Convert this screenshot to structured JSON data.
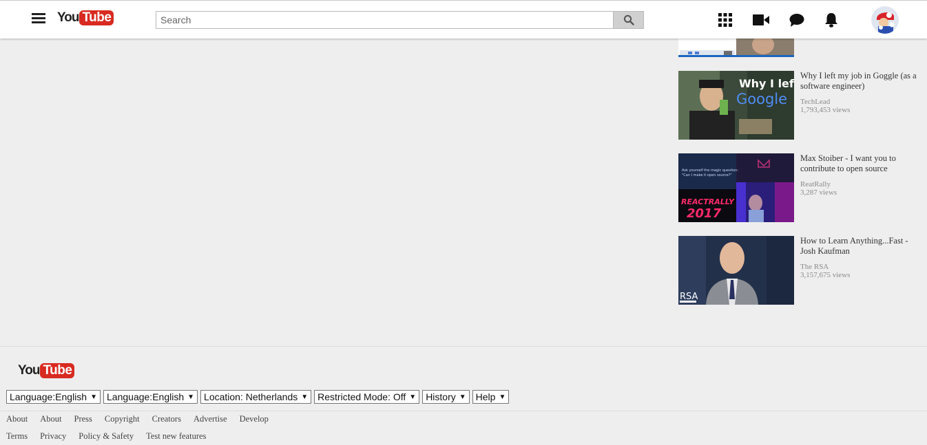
{
  "header": {
    "logo_you": "You",
    "logo_tube": "Tube",
    "search_placeholder": "Search"
  },
  "related": [
    {
      "title": "Why I left my job in Goggle (as a software engineer)",
      "channel": "TechLead",
      "views": "1,793,453 views",
      "thumb_text_1": "Why I left",
      "thumb_text_2": "Google"
    },
    {
      "title": "Max Stoiber - I want you to contribute to open source",
      "channel": "ReatRally",
      "views": "3,287 views",
      "thumb_text_1": "REACTRALLY",
      "thumb_text_2": "2017",
      "thumb_text_3": "Ask yourself the magic question:",
      "thumb_text_4": "\"Can I make it open source?\""
    },
    {
      "title": "How to Learn Anything...Fast - Josh Kaufman",
      "channel": "The RSA",
      "views": "3,157,675 views",
      "thumb_text_1": "RSA"
    }
  ],
  "footer": {
    "logo_you": "You",
    "logo_tube": "Tube",
    "buttons": [
      "Language:English",
      "Language:English",
      "Location: Netherlands",
      "Restricted Mode: Off",
      "History",
      "Help"
    ],
    "links_row1": [
      "About",
      "About",
      "Press",
      "Copyright",
      "Creators",
      "Advertise",
      "Develop"
    ],
    "links_row2": [
      "Terms",
      "Privacy",
      "Policy & Safety",
      "Test new features"
    ]
  },
  "icons": {
    "menu": "hamburger-icon",
    "search": "search-icon",
    "apps": "apps-grid-icon",
    "upload": "video-camera-icon",
    "messages": "chat-bubble-icon",
    "notifications": "bell-icon",
    "dropdown": "dropdown-arrow-icon"
  },
  "colors": {
    "brand_red": "#d82a20",
    "page_bg": "#eeeeee"
  }
}
